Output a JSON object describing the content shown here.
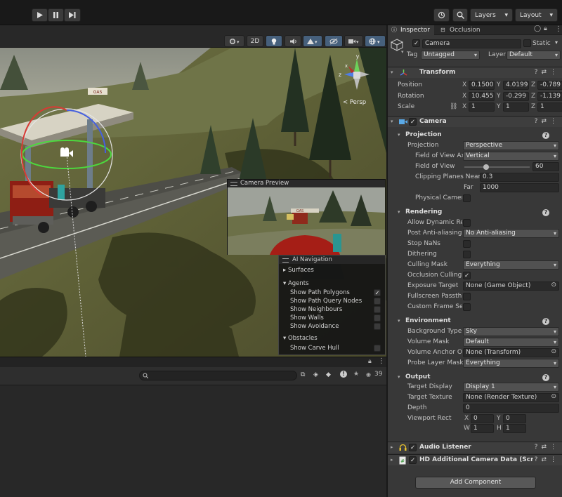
{
  "toolbar": {
    "layers_label": "Layers",
    "layout_label": "Layout"
  },
  "scene": {
    "toolbar": {
      "mode_2d": "2D"
    },
    "gizmo": {
      "projection_label": "< Persp",
      "axis_y": "y",
      "axis_z": "z",
      "axis_x": "x"
    },
    "camera_preview": {
      "title": "Camera Preview",
      "sign_text": "GAS"
    },
    "station_sign": "GAS",
    "ai_navigation": {
      "title": "AI Navigation",
      "surfaces": "Surfaces",
      "agents": "Agents",
      "agent_options": [
        {
          "label": "Show Path Polygons",
          "checked": true
        },
        {
          "label": "Show Path Query Nodes",
          "checked": false
        },
        {
          "label": "Show Neighbours",
          "checked": false
        },
        {
          "label": "Show Walls",
          "checked": false
        },
        {
          "label": "Show Avoidance",
          "checked": false
        }
      ],
      "obstacles": "Obstacles",
      "obstacle_options": [
        {
          "label": "Show Carve Hull",
          "checked": false
        }
      ]
    }
  },
  "bottom_panel": {
    "hidden_count": "39"
  },
  "inspector": {
    "tabs": [
      "Inspector",
      "Occlusion"
    ],
    "object": {
      "name": "Camera",
      "static_label": "Static",
      "tag_label": "Tag",
      "tag_value": "Untagged",
      "layer_label": "Layer",
      "layer_value": "Default"
    },
    "transform": {
      "title": "Transform",
      "position": {
        "label": "Position",
        "x": "0.1500",
        "y": "4.0199",
        "z": "-0.789"
      },
      "rotation": {
        "label": "Rotation",
        "x": "10.455",
        "y": "-0.299",
        "z": "-1.139"
      },
      "scale": {
        "label": "Scale",
        "x": "1",
        "y": "1",
        "z": "1"
      },
      "axes": [
        "X",
        "Y",
        "Z"
      ]
    },
    "camera": {
      "title": "Camera",
      "projection_section": "Projection",
      "projection_label": "Projection",
      "projection_value": "Perspective",
      "fov_axis_label": "Field of View Ax",
      "fov_axis_value": "Vertical",
      "fov_label": "Field of View",
      "fov_value": "60",
      "fov_fraction": 0.33,
      "clipping_label": "Clipping Planes Near",
      "near_value": "0.3",
      "far_label": "Far",
      "far_value": "1000",
      "physical_label": "Physical Camer",
      "rendering_section": "Rendering",
      "dynamic_res_label": "Allow Dynamic Re:",
      "aa_label": "Post Anti-aliasing",
      "aa_value": "No Anti-aliasing",
      "stop_nans_label": "Stop NaNs",
      "dithering_label": "Dithering",
      "culling_label": "Culling Mask",
      "culling_value": "Everything",
      "occlusion_label": "Occlusion Culling",
      "exposure_label": "Exposure Target",
      "exposure_value": "None (Game Object)",
      "fullscreen_label": "Fullscreen Passthr",
      "custom_frame_label": "Custom Frame Set",
      "environment_section": "Environment",
      "bg_type_label": "Background Type",
      "bg_type_value": "Sky",
      "volume_mask_label": "Volume Mask",
      "volume_mask_value": "Default",
      "volume_anchor_label": "Volume Anchor Ov",
      "volume_anchor_value": "None (Transform)",
      "probe_mask_label": "Probe Layer Mask",
      "probe_mask_value": "Everything",
      "output_section": "Output",
      "target_display_label": "Target Display",
      "target_display_value": "Display 1",
      "target_texture_label": "Target Texture",
      "target_texture_value": "None (Render Texture)",
      "depth_label": "Depth",
      "depth_value": "0",
      "viewport_label": "Viewport Rect",
      "viewport": {
        "x_label": "X",
        "x": "0",
        "y_label": "Y",
        "y": "0",
        "w_label": "W",
        "w": "1",
        "h_label": "H",
        "h": "1"
      }
    },
    "audio_listener": {
      "title": "Audio Listener"
    },
    "hd_camera": {
      "title": "HD Additional Camera Data (Script)"
    },
    "add_component": "Add Component"
  }
}
